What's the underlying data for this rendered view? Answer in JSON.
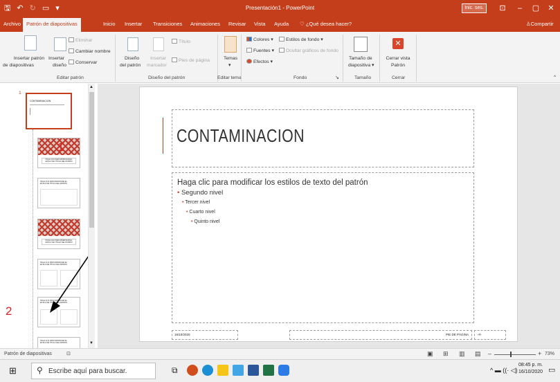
{
  "titlebar": {
    "window_title": "Presentación1 - PowerPoint",
    "signin": "Inic. ses."
  },
  "tabs": [
    "Archivo",
    "Patrón de diapositivas",
    "Inicio",
    "Insertar",
    "Transiciones",
    "Animaciones",
    "Revisar",
    "Vista",
    "Ayuda"
  ],
  "tell_me": "¿Qué desea hacer?",
  "share": "Compartir",
  "ribbon": {
    "insert_master": [
      "Insertar patrón",
      "de diapositivas"
    ],
    "insert_layout": [
      "Insertar",
      "diseño"
    ],
    "delete": "Eliminar",
    "rename": "Cambiar nombre",
    "preserve": "Conservar",
    "group_edit": "Editar patrón",
    "master_layout": [
      "Diseño",
      "del patrón"
    ],
    "insert_placeholder": [
      "Insertar",
      "marcador"
    ],
    "title_cb": "Título",
    "footers_cb": "Pies de página",
    "group_layout": "Diseño del patrón",
    "themes": "Temas",
    "group_theme": "Editar tema",
    "colors": "Colores",
    "fonts": "Fuentes",
    "effects": "Efectos",
    "bg_styles": "Estilos de fondo",
    "hide_bg": "Ocultar gráficos de fondo",
    "group_bg": "Fondo",
    "slide_size": [
      "Tamaño de",
      "diapositiva"
    ],
    "group_size": "Tamaño",
    "close_view": [
      "Cerrar vista",
      "Patrón"
    ],
    "group_close": "Cerrar"
  },
  "thumbs": {
    "number": "1",
    "master_title": "CONTAMINACION",
    "layout_heading": "HAGA CLIC PARA MODIFICAR EL ESTILO DE TÍTULO DEL PATRÓN"
  },
  "annotations": {
    "label1": "1",
    "label2": "2"
  },
  "slide": {
    "title": "CONTAMINACION",
    "body_lines": [
      "Haga clic para modificar los estilos de texto del patrón",
      "Segundo nivel",
      "Tercer nivel",
      "Cuarto nivel",
      "Quinto nivel"
    ],
    "date": "16/10/2020",
    "footer": "PIE DE PÁGINA",
    "number": "‹#›"
  },
  "status": {
    "view": "Patrón de diapositivas",
    "zoom": "73%"
  },
  "taskbar": {
    "search_placeholder": "Escribe aquí para buscar.",
    "time": "08:45 p. m.",
    "date": "16/10/2020"
  },
  "colors": {
    "accent": "#c43e1c",
    "annotation": "#e02020"
  }
}
